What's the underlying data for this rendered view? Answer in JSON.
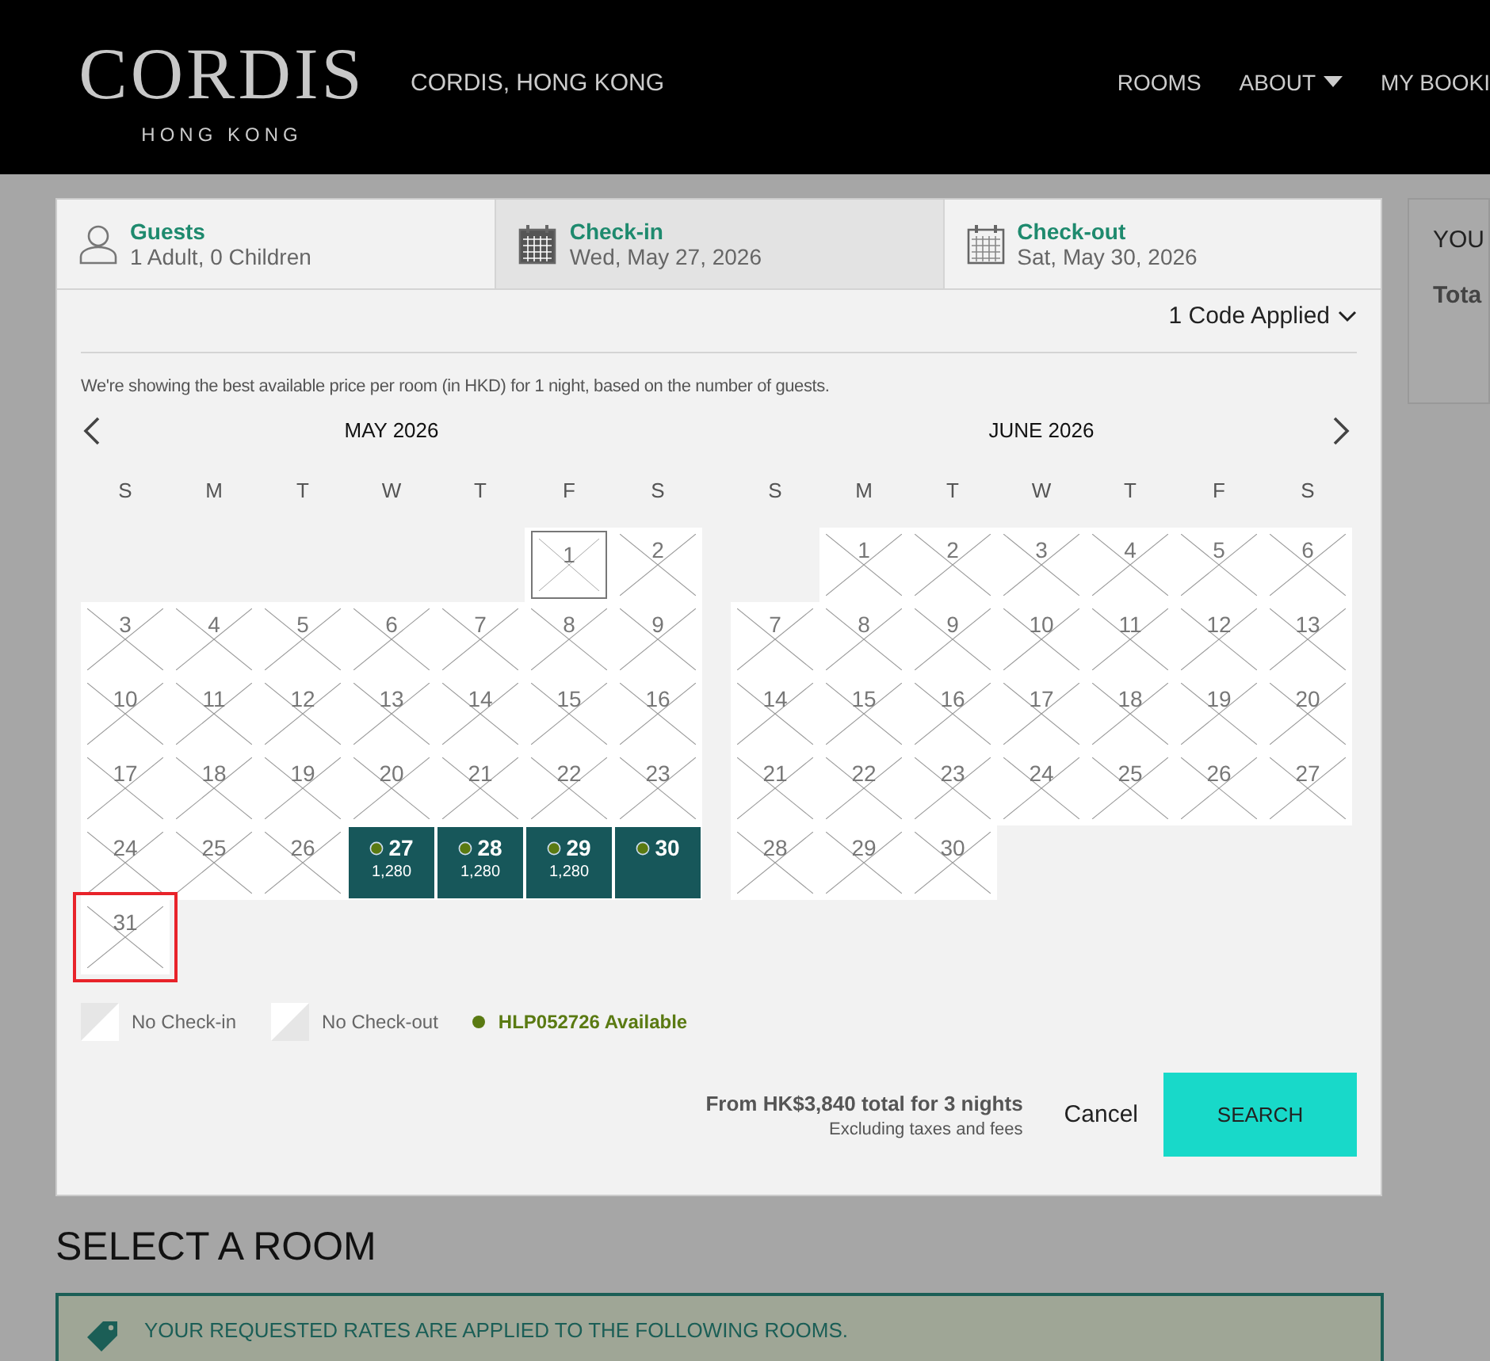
{
  "header": {
    "logo": {
      "name": "CORDIS",
      "sub": "HONG KONG"
    },
    "hotel": "CORDIS, HONG KONG",
    "nav": [
      {
        "label": "ROOMS",
        "dropdown": false
      },
      {
        "label": "ABOUT",
        "dropdown": true
      },
      {
        "label": "MY BOOKI",
        "dropdown": false
      }
    ]
  },
  "search_bar": [
    {
      "kind": "guests",
      "label": "Guests",
      "value": "1 Adult, 0 Children",
      "selected": false
    },
    {
      "kind": "date",
      "label": "Check-in",
      "value": "Wed, May 27, 2026",
      "selected": true
    },
    {
      "kind": "date",
      "label": "Check-out",
      "value": "Sat, May 30, 2026",
      "selected": false
    }
  ],
  "code_applied": "1 Code Applied",
  "info": "We're showing the best available price per room (in HKD) for 1 night, based on the number of guests.",
  "months": [
    {
      "title": "MAY 2026",
      "weekdays": [
        "S",
        "M",
        "T",
        "W",
        "T",
        "F",
        "S"
      ],
      "weeks": [
        [
          {
            "kind": "empty"
          },
          {
            "kind": "empty"
          },
          {
            "kind": "empty"
          },
          {
            "kind": "empty"
          },
          {
            "kind": "empty"
          },
          {
            "day": "1",
            "kind": "today"
          },
          {
            "day": "2",
            "kind": "blocked"
          }
        ],
        [
          {
            "day": "3",
            "kind": "blocked"
          },
          {
            "day": "4",
            "kind": "blocked"
          },
          {
            "day": "5",
            "kind": "blocked"
          },
          {
            "day": "6",
            "kind": "blocked"
          },
          {
            "day": "7",
            "kind": "blocked"
          },
          {
            "day": "8",
            "kind": "blocked"
          },
          {
            "day": "9",
            "kind": "blocked"
          }
        ],
        [
          {
            "day": "10",
            "kind": "blocked"
          },
          {
            "day": "11",
            "kind": "blocked"
          },
          {
            "day": "12",
            "kind": "blocked"
          },
          {
            "day": "13",
            "kind": "blocked"
          },
          {
            "day": "14",
            "kind": "blocked"
          },
          {
            "day": "15",
            "kind": "blocked"
          },
          {
            "day": "16",
            "kind": "blocked"
          }
        ],
        [
          {
            "day": "17",
            "kind": "blocked"
          },
          {
            "day": "18",
            "kind": "blocked"
          },
          {
            "day": "19",
            "kind": "blocked"
          },
          {
            "day": "20",
            "kind": "blocked"
          },
          {
            "day": "21",
            "kind": "blocked"
          },
          {
            "day": "22",
            "kind": "blocked"
          },
          {
            "day": "23",
            "kind": "blocked"
          }
        ],
        [
          {
            "day": "24",
            "kind": "blocked"
          },
          {
            "day": "25",
            "kind": "blocked"
          },
          {
            "day": "26",
            "kind": "blocked"
          },
          {
            "day": "27",
            "kind": "available",
            "price": "1,280"
          },
          {
            "day": "28",
            "kind": "available",
            "price": "1,280"
          },
          {
            "day": "29",
            "kind": "available",
            "price": "1,280"
          },
          {
            "day": "30",
            "kind": "available"
          }
        ],
        [
          {
            "day": "31",
            "kind": "focused"
          }
        ]
      ]
    },
    {
      "title": "JUNE 2026",
      "weekdays": [
        "S",
        "M",
        "T",
        "W",
        "T",
        "F",
        "S"
      ],
      "weeks": [
        [
          {
            "kind": "empty"
          },
          {
            "day": "1",
            "kind": "blocked"
          },
          {
            "day": "2",
            "kind": "blocked"
          },
          {
            "day": "3",
            "kind": "blocked"
          },
          {
            "day": "4",
            "kind": "blocked"
          },
          {
            "day": "5",
            "kind": "blocked"
          },
          {
            "day": "6",
            "kind": "blocked"
          }
        ],
        [
          {
            "day": "7",
            "kind": "blocked"
          },
          {
            "day": "8",
            "kind": "blocked"
          },
          {
            "day": "9",
            "kind": "blocked"
          },
          {
            "day": "10",
            "kind": "blocked"
          },
          {
            "day": "11",
            "kind": "blocked"
          },
          {
            "day": "12",
            "kind": "blocked"
          },
          {
            "day": "13",
            "kind": "blocked"
          }
        ],
        [
          {
            "day": "14",
            "kind": "blocked"
          },
          {
            "day": "15",
            "kind": "blocked"
          },
          {
            "day": "16",
            "kind": "blocked"
          },
          {
            "day": "17",
            "kind": "blocked"
          },
          {
            "day": "18",
            "kind": "blocked"
          },
          {
            "day": "19",
            "kind": "blocked"
          },
          {
            "day": "20",
            "kind": "blocked"
          }
        ],
        [
          {
            "day": "21",
            "kind": "blocked"
          },
          {
            "day": "22",
            "kind": "blocked"
          },
          {
            "day": "23",
            "kind": "blocked"
          },
          {
            "day": "24",
            "kind": "blocked"
          },
          {
            "day": "25",
            "kind": "blocked"
          },
          {
            "day": "26",
            "kind": "blocked"
          },
          {
            "day": "27",
            "kind": "blocked"
          }
        ],
        [
          {
            "day": "28",
            "kind": "blocked"
          },
          {
            "day": "29",
            "kind": "blocked"
          },
          {
            "day": "30",
            "kind": "blocked"
          }
        ]
      ]
    }
  ],
  "legend": [
    {
      "kind": "no-checkin",
      "label": "No Check-in"
    },
    {
      "kind": "no-checkout",
      "label": "No Check-out"
    },
    {
      "kind": "dot",
      "label": "HLP052726 Available",
      "color": "#5a7a12"
    }
  ],
  "total": {
    "main": "From HK$3,840 total for 3 nights",
    "note": "Excluding taxes and fees"
  },
  "buttons": {
    "cancel": "Cancel",
    "search": "SEARCH"
  },
  "summary": {
    "title": "YOU",
    "total": "Tota"
  },
  "section_title": "SELECT A ROOM",
  "notice": "YOUR REQUESTED RATES ARE APPLIED TO THE FOLLOWING ROOMS."
}
